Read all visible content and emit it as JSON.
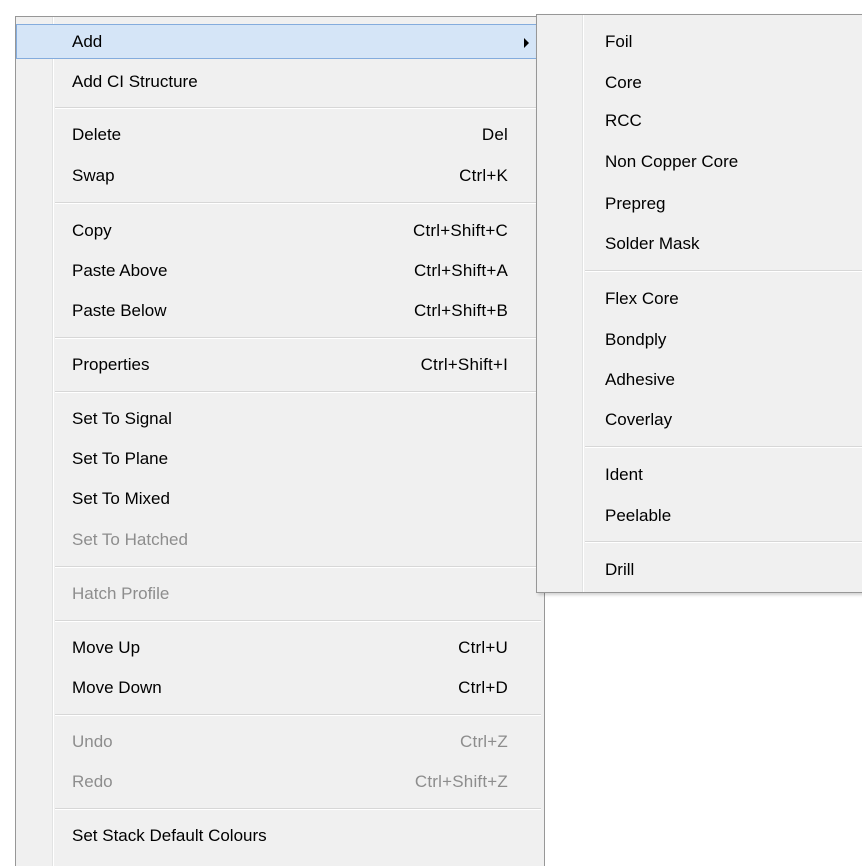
{
  "main_menu": {
    "items": [
      {
        "label": "Add",
        "shortcut": "",
        "enabled": true,
        "has_submenu": true,
        "highlighted": true
      },
      {
        "label": "Add CI Structure",
        "shortcut": "",
        "enabled": true
      },
      {
        "label": "Delete",
        "shortcut": "Del",
        "enabled": true
      },
      {
        "label": "Swap",
        "shortcut": "Ctrl+K",
        "enabled": true
      },
      {
        "label": "Copy",
        "shortcut": "Ctrl+Shift+C",
        "enabled": true
      },
      {
        "label": "Paste Above",
        "shortcut": "Ctrl+Shift+A",
        "enabled": true
      },
      {
        "label": "Paste Below",
        "shortcut": "Ctrl+Shift+B",
        "enabled": true
      },
      {
        "label": "Properties",
        "shortcut": "Ctrl+Shift+I",
        "enabled": true
      },
      {
        "label": "Set To Signal",
        "shortcut": "",
        "enabled": true
      },
      {
        "label": "Set To Plane",
        "shortcut": "",
        "enabled": true
      },
      {
        "label": "Set To Mixed",
        "shortcut": "",
        "enabled": true
      },
      {
        "label": "Set To Hatched",
        "shortcut": "",
        "enabled": false
      },
      {
        "label": "Hatch Profile",
        "shortcut": "",
        "enabled": false
      },
      {
        "label": "Move Up",
        "shortcut": "Ctrl+U",
        "enabled": true
      },
      {
        "label": "Move Down",
        "shortcut": "Ctrl+D",
        "enabled": true
      },
      {
        "label": "Undo",
        "shortcut": "Ctrl+Z",
        "enabled": false
      },
      {
        "label": "Redo",
        "shortcut": "Ctrl+Shift+Z",
        "enabled": false
      },
      {
        "label": "Set Stack Default Colours",
        "shortcut": "",
        "enabled": true
      }
    ]
  },
  "sub_menu": {
    "items": [
      {
        "label": "Foil"
      },
      {
        "label": "Core"
      },
      {
        "label": "RCC"
      },
      {
        "label": "Non Copper Core"
      },
      {
        "label": "Prepreg"
      },
      {
        "label": "Solder Mask"
      },
      {
        "label": "Flex Core"
      },
      {
        "label": "Bondply"
      },
      {
        "label": "Adhesive"
      },
      {
        "label": "Coverlay"
      },
      {
        "label": "Ident"
      },
      {
        "label": "Peelable"
      },
      {
        "label": "Drill"
      }
    ]
  },
  "colors": {
    "menu_background": "#f0f0f0",
    "highlight_background": "#d5e5f7",
    "highlight_border": "#84acdd",
    "disabled_text": "#8d8d8d"
  },
  "icons": {
    "submenu_arrow": "chevron-right-icon"
  }
}
